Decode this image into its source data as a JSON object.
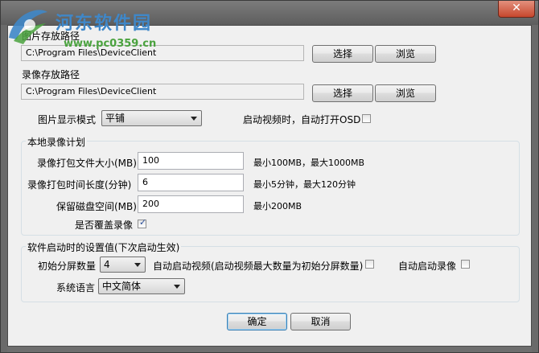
{
  "colors": {
    "window_frame": "#6e6e6e",
    "client_bg": "#f0f0f0",
    "close_button": "#c7472d",
    "watermark_title": "#3f87c8",
    "watermark_url": "#4aa23e"
  },
  "watermark": {
    "title": "河东软件园",
    "url": "www.pc0359.cn"
  },
  "window": {
    "close_glyph": "✕"
  },
  "image_path": {
    "label": "图片存放路径",
    "value": "C:\\Program Files\\DeviceClient",
    "select_button": "选择",
    "browse_button": "浏览"
  },
  "record_path": {
    "label": "录像存放路径",
    "value": "C:\\Program Files\\DeviceClient",
    "select_button": "选择",
    "browse_button": "浏览"
  },
  "display_mode": {
    "label": "图片显示模式",
    "value": "平铺"
  },
  "osd": {
    "label": "启动视频时，自动打开OSD",
    "checked": false
  },
  "local_record": {
    "title": "本地录像计划",
    "pack_size": {
      "label": "录像打包文件大小(MB)",
      "value": "100",
      "hint": "最小100MB，最大1000MB"
    },
    "pack_time": {
      "label": "录像打包时间长度(分钟)",
      "value": "6",
      "hint": "最小5分钟，最大120分钟"
    },
    "reserve": {
      "label": "保留磁盘空间(MB)",
      "value": "200",
      "hint": "最小200MB"
    },
    "overwrite": {
      "label": "是否覆盖录像",
      "checked": true,
      "tick": "✓"
    }
  },
  "startup": {
    "title": "软件启动时的设置值(下次启动生效)",
    "split": {
      "label": "初始分屏数量",
      "value": "4"
    },
    "auto_video": {
      "label": "自动启动视频(启动视频最大数量为初始分屏数量)",
      "checked": false
    },
    "auto_record": {
      "label": "自动启动录像",
      "checked": false
    },
    "language": {
      "label": "系统语言",
      "value": "中文简体"
    }
  },
  "footer": {
    "ok": "确定",
    "cancel": "取消"
  }
}
